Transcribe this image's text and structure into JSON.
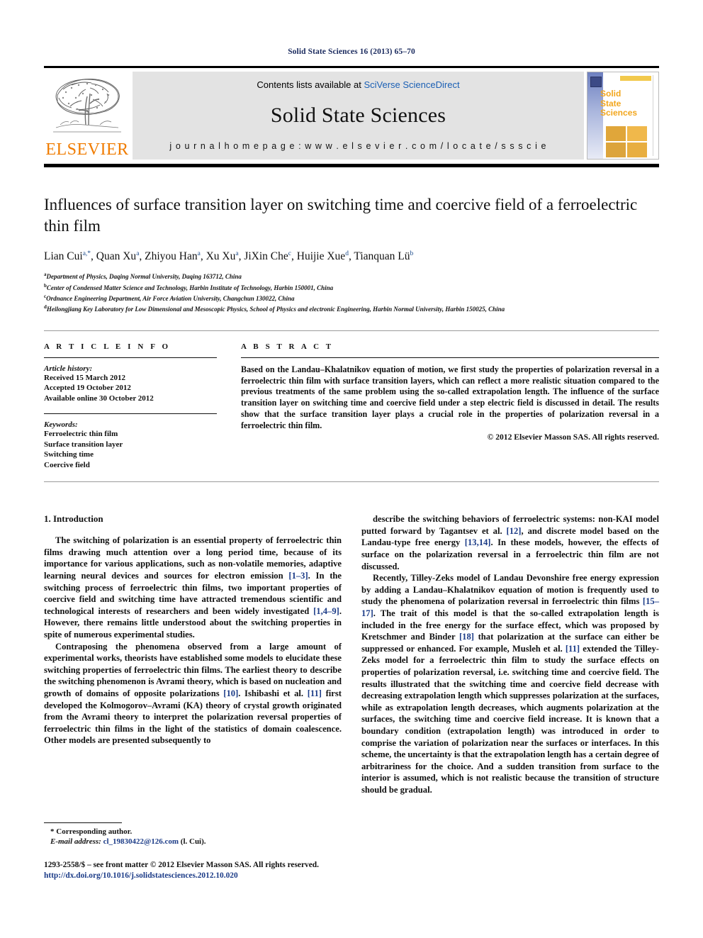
{
  "running_head": "Solid State Sciences 16 (2013) 65–70",
  "masthead": {
    "publisher_name": "ELSEVIER",
    "contents_prefix": "Contents lists available at ",
    "contents_link": "SciVerse ScienceDirect",
    "journal_name": "Solid State Sciences",
    "homepage_line": "j o u r n a l   h o m e p a g e :   w w w . e l s e v i e r . c o m / l o c a t e / s s s c i e",
    "cover": {
      "line1": "Solid",
      "line2": "State",
      "line3": "Sciences"
    }
  },
  "article": {
    "title": "Influences of surface transition layer on switching time and coercive field of a ferroelectric thin film",
    "authors_html": "Lian Cui<sup>a,*</sup>, Quan Xu<sup>a</sup>, Zhiyou Han<sup>a</sup>, Xu Xu<sup>a</sup>, JiXin Che<sup>c</sup>, Huijie Xue<sup>d</sup>, Tianquan Lü<sup>b</sup>",
    "affiliations": [
      {
        "mark": "a",
        "text": "Department of Physics, Daqing Normal University, Daqing 163712, China"
      },
      {
        "mark": "b",
        "text": "Center of Condensed Matter Science and Technology, Harbin Institute of Technology, Harbin 150001, China"
      },
      {
        "mark": "c",
        "text": "Ordnance Engineering Department, Air Force Aviation University, Changchun 130022, China"
      },
      {
        "mark": "d",
        "text": "Heilongjiang Key Laboratory for Low Dimensional and Mesoscopic Physics, School of Physics and electronic Engineering, Harbin Normal University, Harbin 150025, China"
      }
    ]
  },
  "article_info": {
    "heading": "A R T I C L E   I N F O",
    "history_label": "Article history:",
    "history": [
      "Received 15 March 2012",
      "Accepted 19 October 2012",
      "Available online 30 October 2012"
    ],
    "keywords_label": "Keywords:",
    "keywords": [
      "Ferroelectric thin film",
      "Surface transition layer",
      "Switching time",
      "Coercive field"
    ]
  },
  "abstract": {
    "heading": "A B S T R A C T",
    "text": "Based on the Landau–Khalatnikov equation of motion, we first study the properties of polarization reversal in a ferroelectric thin film with surface transition layers, which can reflect a more realistic situation compared to the previous treatments of the same problem using the so-called extrapolation length. The influence of the surface transition layer on switching time and coercive field under a step electric field is discussed in detail. The results show that the surface transition layer plays a crucial role in the properties of polarization reversal in a ferroelectric thin film.",
    "copyright": "© 2012 Elsevier Masson SAS. All rights reserved."
  },
  "body": {
    "section_number_title": "1.  Introduction",
    "left_paragraphs_html": [
      "The switching of polarization is an essential property of ferroelectric thin films drawing much attention over a long period time, because of its importance for various applications, such as non-volatile memories, adaptive learning neural devices and sources for electron emission <span class=\"ref\">[1–3]</span>. In the switching process of ferroelectric thin films, two important properties of coercive field and switching time have attracted tremendous scientific and technological interests of researchers and been widely investigated <span class=\"ref\">[1,4–9]</span>. However, there remains little understood about the switching properties in spite of numerous experimental studies.",
      "Contraposing the phenomena observed from a large amount of experimental works, theorists have established some models to elucidate these switching properties of ferroelectric thin films. The earliest theory to describe the switching phenomenon is Avrami theory, which is based on nucleation and growth of domains of opposite polarizations <span class=\"ref\">[10]</span>. Ishibashi et al. <span class=\"ref\">[11]</span> first developed the Kolmogorov–Avrami (KA) theory of crystal growth originated from the Avrami theory to interpret the polarization reversal properties of ferroelectric thin films in the light of the statistics of domain coalescence. Other models are presented subsequently to"
    ],
    "right_paragraphs_html": [
      "describe the switching behaviors of ferroelectric systems: non-KAI model putted forward by Tagantsev et al. <span class=\"ref\">[12]</span>, and discrete model based on the Landau-type free energy <span class=\"ref\">[13,14]</span>. In these models, however, the effects of surface on the polarization reversal in a ferroelectric thin film are not discussed.",
      "Recently, Tilley-Zeks model of Landau Devonshire free energy expression by adding a Landau–Khalatnikov equation of motion is frequently used to study the phenomena of polarization reversal in ferroelectric thin films <span class=\"ref\">[15–17]</span>. The trait of this model is that the so-called extrapolation length is included in the free energy for the surface effect, which was proposed by Kretschmer and Binder <span class=\"ref\">[18]</span> that polarization at the surface can either be suppressed or enhanced. For example, Musleh et al. <span class=\"ref\">[11]</span> extended the Tilley-Zeks model for a ferroelectric thin film to study the surface effects on properties of polarization reversal, i.e. switching time and coercive field. The results illustrated that the switching time and coercive field decrease with decreasing extrapolation length which suppresses polarization at the surfaces, while as extrapolation length decreases, which augments polarization at the surfaces, the switching time and coercive field increase. It is known that a boundary condition (extrapolation length) was introduced in order to comprise the variation of polarization near the surfaces or interfaces. In this scheme, the uncertainty is that the extrapolation length has a certain degree of arbitrariness for the choice. And a sudden transition from surface to the interior is assumed, which is not realistic because the transition of structure should be gradual."
    ]
  },
  "footnotes": {
    "corresponding": "* Corresponding author.",
    "email_label": "E-mail address:",
    "email": "cl_19830422@126.com",
    "email_suffix": "(l. Cui)."
  },
  "issn_block": {
    "line1": "1293-2558/$ – see front matter © 2012 Elsevier Masson SAS. All rights reserved.",
    "doi": "http://dx.doi.org/10.1016/j.solidstatesciences.2012.10.020"
  },
  "colors": {
    "link_blue": "#1b3b87",
    "elsevier_orange": "#F07C00",
    "sciencedirect_blue": "#1a5fb4",
    "masthead_gray": "#e3e3e3"
  }
}
